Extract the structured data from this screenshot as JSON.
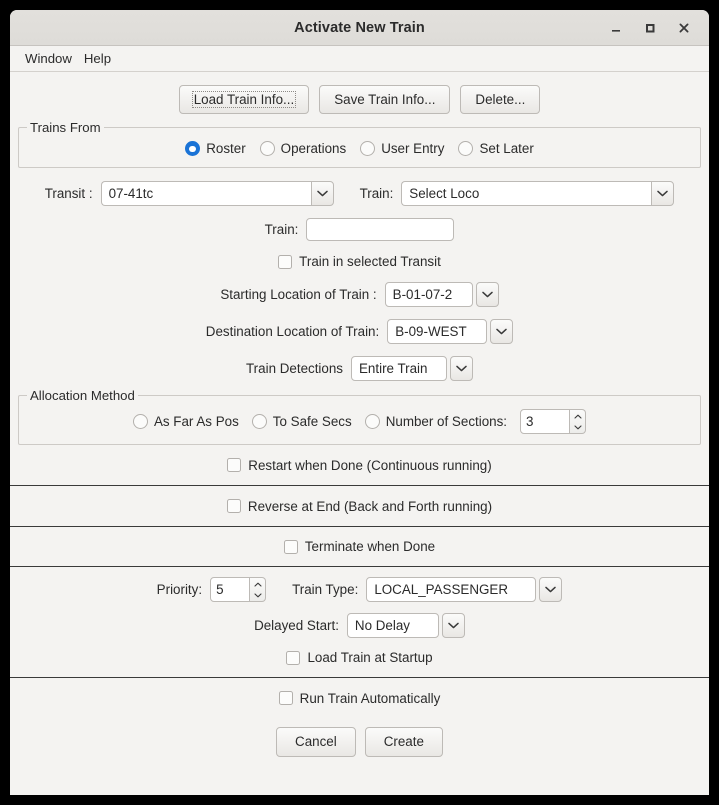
{
  "window": {
    "title": "Activate New Train",
    "controls": [
      {
        "name": "minimize-button",
        "glyph": "minimize"
      },
      {
        "name": "maximize-button",
        "glyph": "maximize"
      },
      {
        "name": "close-button",
        "glyph": "close"
      }
    ]
  },
  "menubar": {
    "items": [
      {
        "label": "Window"
      },
      {
        "label": "Help"
      }
    ]
  },
  "toolbar": {
    "load_label": "Load Train Info...",
    "save_label": "Save Train Info...",
    "delete_label": "Delete..."
  },
  "trains_from": {
    "group_title": "Trains From",
    "options": [
      {
        "label": "Roster",
        "selected": true
      },
      {
        "label": "Operations",
        "selected": false
      },
      {
        "label": "User Entry",
        "selected": false
      },
      {
        "label": "Set Later",
        "selected": false
      }
    ]
  },
  "transit": {
    "label": "Transit :",
    "value": "07-41tc"
  },
  "train_select": {
    "label": "Train:",
    "value": "Select Loco"
  },
  "train_name": {
    "label": "Train:",
    "value": "",
    "placeholder": ""
  },
  "train_in_transit": {
    "label": "Train in selected Transit",
    "checked": false
  },
  "starting_location": {
    "label": "Starting Location of Train :",
    "value": "B-01-07-2"
  },
  "destination_location": {
    "label": "Destination Location of Train:",
    "value": "B-09-WEST"
  },
  "train_detections": {
    "label": "Train Detections",
    "value": "Entire Train"
  },
  "allocation_method": {
    "group_title": "Allocation Method",
    "options": [
      {
        "label": "As Far As Pos",
        "selected": false
      },
      {
        "label": "To Safe Secs",
        "selected": false
      },
      {
        "label": "Number of Sections:",
        "selected": false
      }
    ],
    "sections_value": "3"
  },
  "restart_when_done": {
    "label": "Restart when Done (Continuous running)",
    "checked": false
  },
  "reverse_at_end": {
    "label": "Reverse at End (Back and Forth running)",
    "checked": false
  },
  "terminate_when_done": {
    "label": "Terminate when Done",
    "checked": false
  },
  "priority": {
    "label": "Priority:",
    "value": "5"
  },
  "train_type": {
    "label": "Train Type:",
    "value": "LOCAL_PASSENGER"
  },
  "delayed_start": {
    "label": "Delayed Start:",
    "value": "No Delay"
  },
  "load_at_startup": {
    "label": "Load Train at Startup",
    "checked": false
  },
  "run_automatically": {
    "label": "Run Train Automatically",
    "checked": false
  },
  "footer": {
    "cancel_label": "Cancel",
    "create_label": "Create"
  },
  "colors": {
    "accent": "#1a73d6",
    "window_bg": "#f4f3f1",
    "titlebar_bg": "#e2e0dc",
    "text": "#2b2b2b",
    "border": "#bdbab6"
  }
}
